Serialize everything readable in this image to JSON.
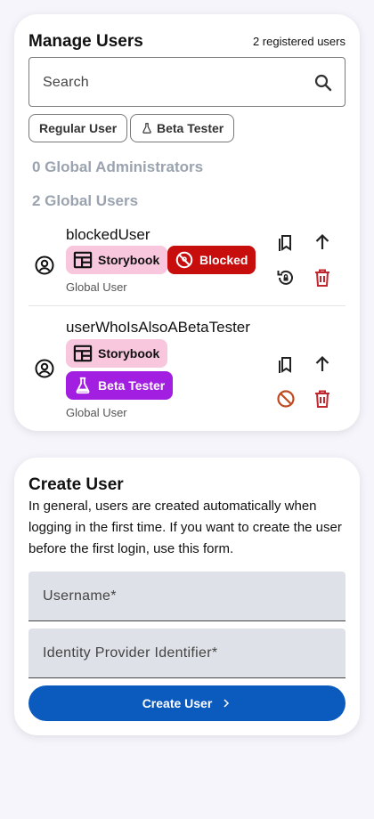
{
  "manage": {
    "title": "Manage Users",
    "count_text": "2 registered users",
    "search_placeholder": "Search",
    "filters": [
      {
        "label": "Regular User",
        "icon": "none"
      },
      {
        "label": "Beta Tester",
        "icon": "flask-icon"
      }
    ],
    "sections": {
      "admins": "0 Global Administrators",
      "users": "2 Global Users"
    },
    "users": [
      {
        "name": "blockedUser",
        "chips": [
          {
            "label": "Storybook",
            "icon": "table-icon",
            "color": "#f8c7dd"
          },
          {
            "label": "Blocked",
            "icon": "blocked-icon",
            "color": "#c80d0d"
          }
        ],
        "role": "Global User"
      },
      {
        "name": "userWhoIsAlsoABetaTester",
        "chips": [
          {
            "label": "Storybook",
            "icon": "table-icon",
            "color": "#f8c7dd"
          },
          {
            "label": "Beta Tester",
            "icon": "flask-icon",
            "color": "#a21ee0"
          }
        ],
        "role": "Global User"
      }
    ]
  },
  "create": {
    "title": "Create User",
    "description": "In general, users are created automatically when logging in the first time. If you want to create the user before the first login, use this form.",
    "username_placeholder": "Username*",
    "idp_placeholder": "Identity Provider Identifier*",
    "button_label": "Create User"
  },
  "colors": {
    "primary": "#0b5bbf",
    "danger": "#c80d0d",
    "beta": "#a21ee0",
    "storybook": "#f8c7dd",
    "block_action": "#bf4a1f"
  }
}
